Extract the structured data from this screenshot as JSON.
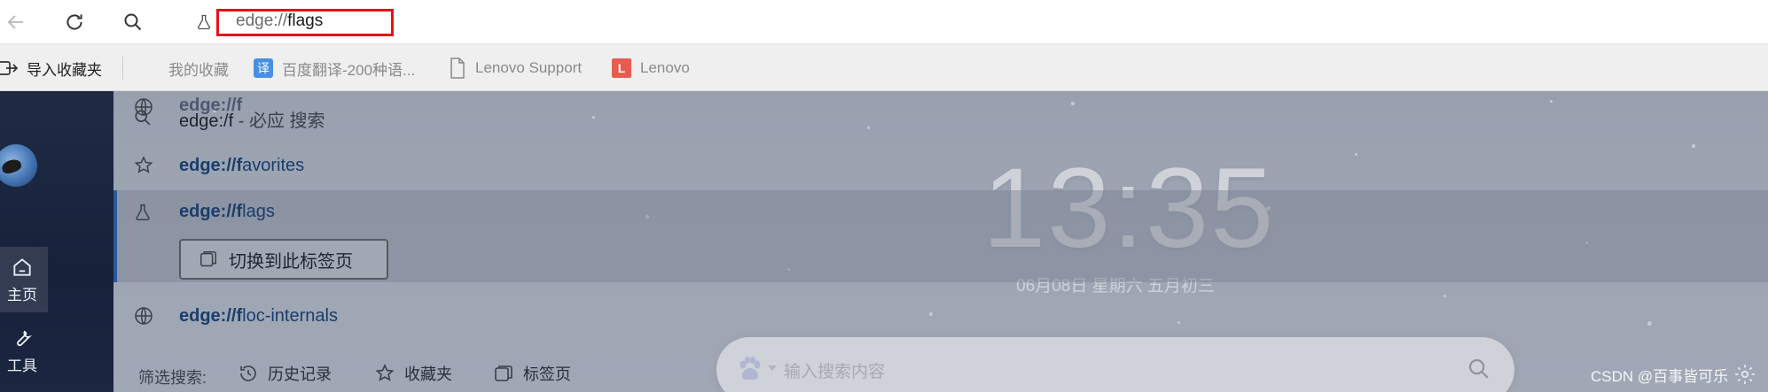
{
  "toolbar": {
    "back_icon": "back-arrow-icon",
    "refresh_icon": "refresh-icon",
    "search_icon": "search-icon",
    "address": {
      "prefix": "edge://",
      "typed": "flags"
    }
  },
  "bookmarks": {
    "import_label": "导入收藏夹",
    "items": [
      {
        "label": "我的收藏",
        "icon": "globe-icon"
      },
      {
        "label": "百度翻译-200种语...",
        "icon": "translate-icon",
        "badge": "译"
      },
      {
        "label": "Lenovo Support",
        "icon": "page-icon"
      },
      {
        "label": "Lenovo",
        "icon": "lenovo-icon",
        "badge": "L"
      }
    ]
  },
  "sidebar": {
    "home_label": "主页",
    "tools_label": "工具"
  },
  "suggestions": {
    "overlap_text": "edge://f",
    "search_row": {
      "query": "edge:/f",
      "suffix": " - 必应 搜索"
    },
    "rows": [
      {
        "bold": "edge://f",
        "rest": "avorites",
        "icon": "favorites-star-icon"
      },
      {
        "bold": "edge://f",
        "rest": "lags",
        "icon": "flask-icon"
      },
      {
        "bold": "edge://f",
        "rest": "loc-internals",
        "icon": "globe-icon"
      }
    ],
    "switch_tab_label": "切换到此标签页"
  },
  "filter": {
    "label": "筛选搜索:",
    "items": [
      {
        "label": "历史记录",
        "icon": "history-icon"
      },
      {
        "label": "收藏夹",
        "icon": "star-icon"
      },
      {
        "label": "标签页",
        "icon": "tabs-icon"
      }
    ]
  },
  "newtab": {
    "time": "13:35",
    "date": "06月08日 星期六 五月初三",
    "search_placeholder": "输入搜索内容"
  },
  "watermark": "CSDN @百事皆可乐",
  "colors": {
    "accent_blue": "#1a3d6b",
    "highlight_red": "#e0141a",
    "sidebar_bg": "#1f2b45"
  }
}
